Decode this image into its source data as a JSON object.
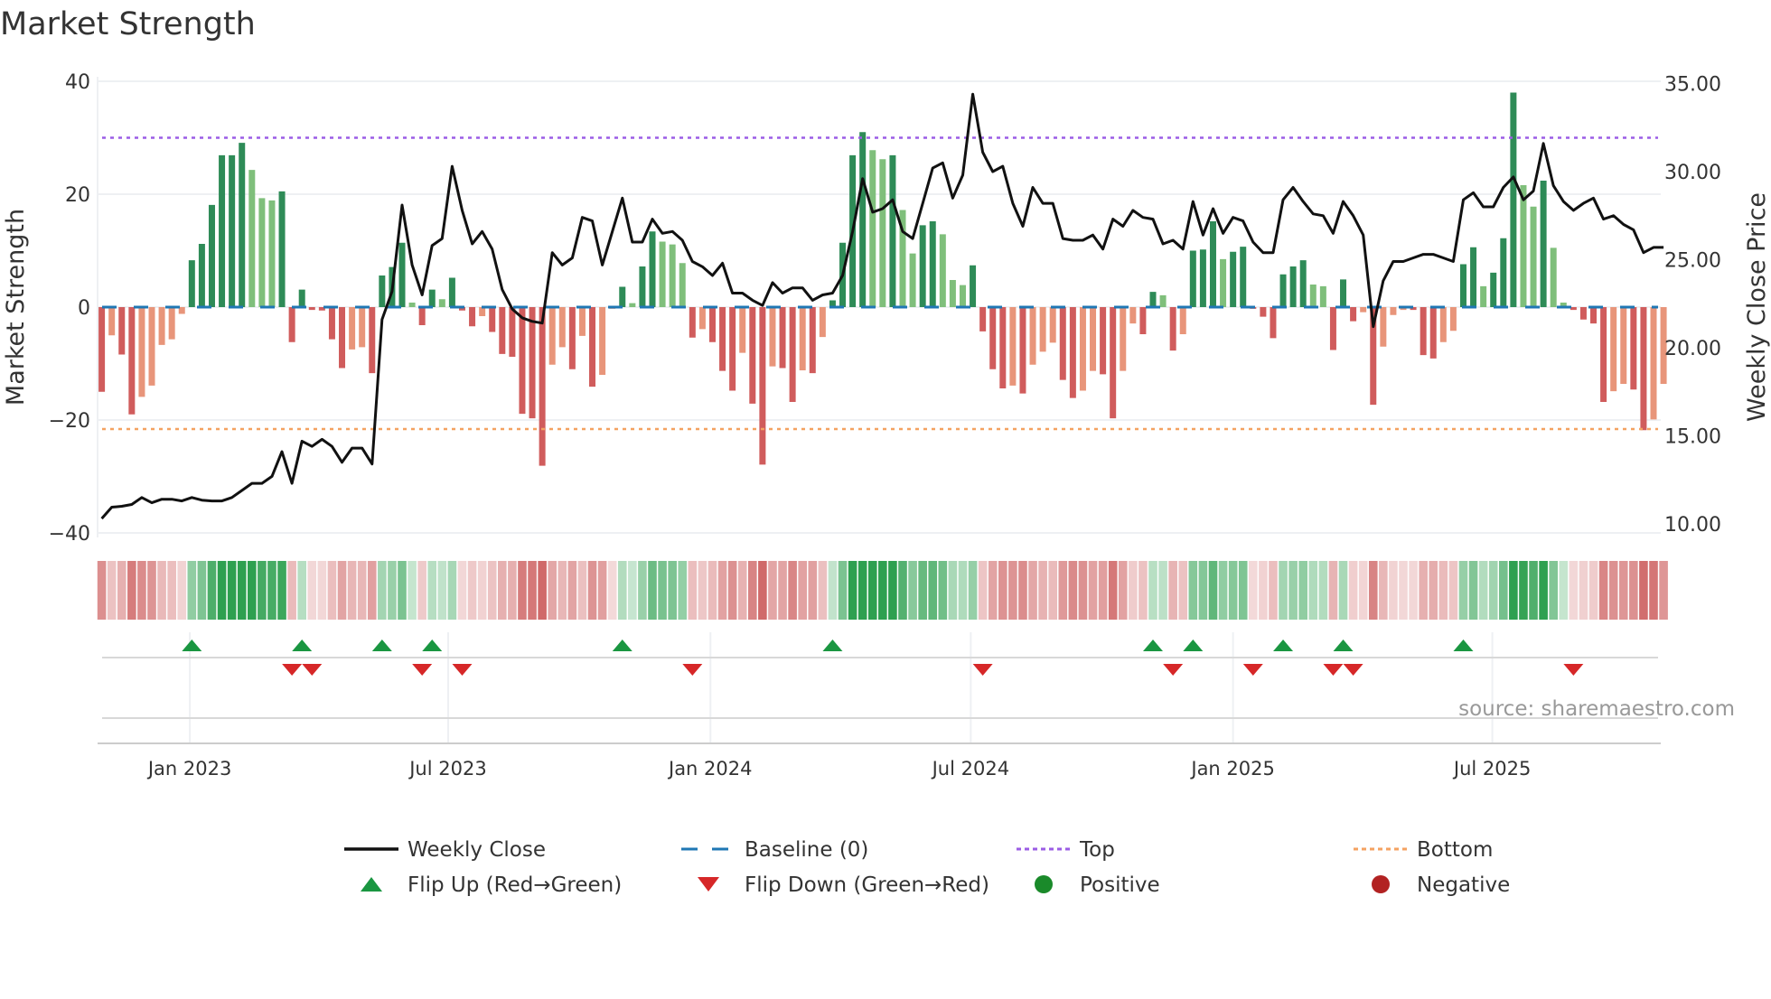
{
  "chart_data": {
    "type": "bar",
    "title": "Market Strength",
    "ylabel": "Market Strength",
    "y2label": "Weekly Close Price",
    "ylim": [
      -40,
      40
    ],
    "y2lim": [
      10,
      35
    ],
    "yticks": [
      "40",
      "20",
      "0",
      "−20",
      "−40"
    ],
    "ytick_values": [
      40,
      20,
      0,
      -20,
      -40
    ],
    "y2ticks": [
      "35.00",
      "30.00",
      "25.00",
      "20.00",
      "15.00",
      "10.00"
    ],
    "y2tick_values": [
      35,
      30,
      25,
      20,
      15,
      10
    ],
    "xticks": [
      {
        "label": "Jan 2023",
        "week": 8.8
      },
      {
        "label": "Jul 2023",
        "week": 34.6
      },
      {
        "label": "Jan 2024",
        "week": 60.8
      },
      {
        "label": "Jul 2024",
        "week": 86.8
      },
      {
        "label": "Jan 2025",
        "week": 113.0
      },
      {
        "label": "Jul 2025",
        "week": 138.9
      }
    ],
    "top_level": 30,
    "bottom_level": -21.6,
    "baseline": 0,
    "strength": [
      -15,
      -5,
      -8.4,
      -19,
      -15.9,
      -13.9,
      -6.7,
      -5.7,
      -1.2,
      8.3,
      11.2,
      18.1,
      26.9,
      26.9,
      29.1,
      24.3,
      19.3,
      18.9,
      20.5,
      -6.2,
      3.1,
      -0.5,
      -0.6,
      -5.7,
      -10.8,
      -7.5,
      -7.1,
      -11.7,
      5.6,
      7.1,
      11.4,
      0.8,
      -3.2,
      3.1,
      1.4,
      5.2,
      -0.6,
      -3.4,
      -1.6,
      -4.4,
      -8.3,
      -8.8,
      -18.9,
      -19.7,
      -28.1,
      -10.2,
      -7.1,
      -11,
      -5.1,
      -14.1,
      -12,
      -0.3,
      3.6,
      0.7,
      7.2,
      13.4,
      11.6,
      11.1,
      7.8,
      -5.4,
      -3.9,
      -6.2,
      -11.3,
      -14.8,
      -8.1,
      -17.1,
      -27.9,
      -10.5,
      -10.8,
      -16.8,
      -11.2,
      -11.7,
      -5.3,
      1.2,
      11.4,
      26.9,
      31,
      27.8,
      26.2,
      26.9,
      17.2,
      9.5,
      14.5,
      15.2,
      12.9,
      4.8,
      3.9,
      7.4,
      -4.3,
      -11,
      -14.4,
      -13.9,
      -15.3,
      -10.2,
      -7.9,
      -6.3,
      -12.9,
      -16.1,
      -14.8,
      -11.3,
      -11.9,
      -19.7,
      -11.3,
      -2.9,
      -4.8,
      2.7,
      2.1,
      -7.7,
      -4.8,
      10,
      10.2,
      15.2,
      8.5,
      9.8,
      10.7,
      -0.3,
      -1.7,
      -5.5,
      5.8,
      7.2,
      8.3,
      4,
      3.7,
      -7.6,
      4.9,
      -2.5,
      -0.9,
      -17.3,
      -7,
      -1.4,
      -0.5,
      -0.5,
      -8.5,
      -9.1,
      -6.2,
      -4.2,
      7.6,
      10.6,
      3.7,
      6.1,
      12.2,
      38,
      21.6,
      17.8,
      22.4,
      10.5,
      0.8,
      -0.5,
      -2.2,
      -2.9,
      -16.8,
      -14.9,
      -13.6,
      -14.6,
      -21.8,
      -19.9,
      -13.6
    ],
    "weekly_close": [
      10.3,
      10.95,
      11,
      11.1,
      11.5,
      11.2,
      11.4,
      11.4,
      11.3,
      11.5,
      11.35,
      11.3,
      11.3,
      11.5,
      11.9,
      12.3,
      12.3,
      12.7,
      14.1,
      12.3,
      14.7,
      14.4,
      14.8,
      14.4,
      13.5,
      14.3,
      14.3,
      13.4,
      21.6,
      23.2,
      28.1,
      24.7,
      23,
      25.8,
      26.2,
      30.3,
      27.8,
      25.9,
      26.6,
      25.6,
      23.3,
      22.2,
      21.7,
      21.5,
      21.4,
      25.4,
      24.7,
      25.1,
      27.4,
      27.2,
      24.7,
      26.6,
      28.5,
      26,
      26,
      27.3,
      26.5,
      26.6,
      26.1,
      24.9,
      24.6,
      24.1,
      24.8,
      23.1,
      23.1,
      22.7,
      22.4,
      23.7,
      23.1,
      23.4,
      23.4,
      22.7,
      23,
      23.1,
      24.1,
      26.6,
      29.6,
      27.7,
      27.9,
      28.4,
      26.6,
      26.2,
      28.2,
      30.2,
      30.5,
      28.5,
      29.8,
      34.4,
      31.1,
      30,
      30.3,
      28.2,
      26.9,
      29.1,
      28.2,
      28.2,
      26.2,
      26.1,
      26.1,
      26.4,
      25.6,
      27.3,
      26.9,
      27.8,
      27.4,
      27.3,
      25.9,
      26.1,
      25.6,
      28.3,
      26.4,
      27.9,
      26.5,
      27.4,
      27.2,
      26,
      25.4,
      25.4,
      28.4,
      29.1,
      28.3,
      27.6,
      27.5,
      26.5,
      28.3,
      27.5,
      26.4,
      21.2,
      23.8,
      24.9,
      24.9,
      25.1,
      25.3,
      25.3,
      25.1,
      24.9,
      28.4,
      28.8,
      28,
      28,
      29.1,
      29.7,
      28.4,
      28.9,
      31.6,
      29.2,
      28.3,
      27.8,
      28.2,
      28.5,
      27.3,
      27.5,
      27,
      26.7,
      25.4,
      25.7,
      25.7
    ],
    "legend": [
      {
        "label": "Weekly Close",
        "symbol": "line"
      },
      {
        "label": "Baseline (0)",
        "symbol": "dash"
      },
      {
        "label": "Top",
        "symbol": "dot-purple"
      },
      {
        "label": "Bottom",
        "symbol": "dot-orange"
      },
      {
        "label": "Flip Up (Red→Green)",
        "symbol": "tri-up"
      },
      {
        "label": "Flip Down (Green→Red)",
        "symbol": "tri-down"
      },
      {
        "label": "Positive",
        "symbol": "circle-green"
      },
      {
        "label": "Negative",
        "symbol": "circle-red"
      }
    ],
    "legend_placement": "bottom"
  },
  "source": "source: sharemaestro.com",
  "colors": {
    "pos_strong": "#2e8b57",
    "pos_weak": "#7fbf7b",
    "neg_strong": "#d05c5c",
    "neg_weak": "#e8957a",
    "line": "#111111",
    "baseline": "#1f77b4",
    "top": "#9b5de5",
    "bottom": "#f4a261",
    "flip_up": "#1a9641",
    "flip_down": "#d62728",
    "positive": "#1a8a2a",
    "negative": "#b22222"
  }
}
